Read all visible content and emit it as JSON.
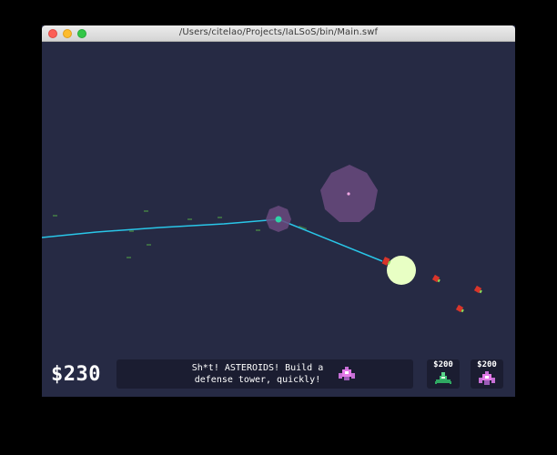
{
  "window": {
    "title": "/Users/citelao/Projects/IaLSoS/bin/Main.swf"
  },
  "hud": {
    "money": "$230",
    "message_line1": "Sh*t! ASTEROIDS! Build a",
    "message_line2": "defense tower, quickly!",
    "message_icon": "purple-tower-icon",
    "shop": [
      {
        "price": "$200",
        "icon": "green-tower-icon"
      },
      {
        "price": "$200",
        "icon": "purple-tower-icon"
      }
    ]
  },
  "colors": {
    "background": "#262a44",
    "hud_panel": "#1b1d31",
    "laser": "#29c6e8",
    "tower_range": "#6a4a7e",
    "projectile": "#e8ffc4",
    "asteroid": "#d8352a"
  }
}
